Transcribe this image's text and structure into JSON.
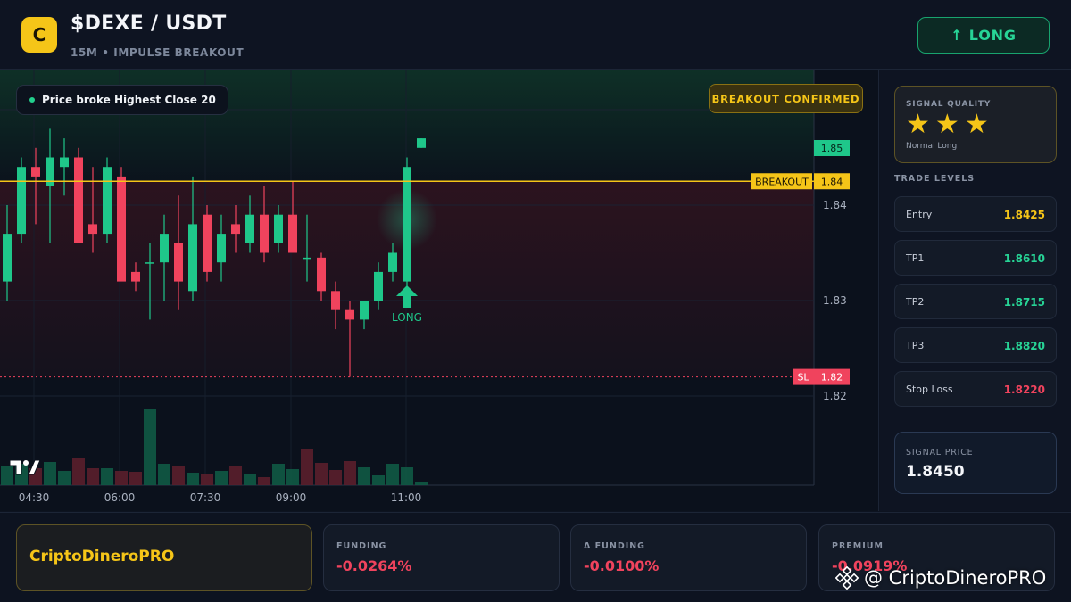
{
  "header": {
    "logo_letter": "C",
    "pair": "$DEXE / USDT",
    "subtitle": "15M • IMPULSE BREAKOUT",
    "signal_button": "↑ LONG"
  },
  "chart": {
    "annotation": "Price broke Highest Close 20",
    "status_badge": "BREAKOUT CONFIRMED",
    "signal_marker_label": "LONG",
    "breakout_label": "BREAKOUT",
    "sl_label": "SL"
  },
  "right_panel": {
    "quality_label": "SIGNAL QUALITY",
    "quality_stars": 3,
    "quality_desc": "Normal Long",
    "levels_title": "TRADE LEVELS",
    "levels": [
      {
        "label": "Entry",
        "value": "1.8425",
        "color": "#f5c518"
      },
      {
        "label": "TP1",
        "value": "1.8610",
        "color": "#27d496"
      },
      {
        "label": "TP2",
        "value": "1.8715",
        "color": "#27d496"
      },
      {
        "label": "TP3",
        "value": "1.8820",
        "color": "#27d496"
      },
      {
        "label": "Stop Loss",
        "value": "1.8220",
        "color": "#f0435d"
      }
    ],
    "signal_price_label": "SIGNAL PRICE",
    "signal_price": "1.8450"
  },
  "bottom": {
    "brand": "CriptoDineroPRO",
    "metrics": [
      {
        "label": "FUNDING",
        "value": "-0.0264%"
      },
      {
        "label": "Δ FUNDING",
        "value": "-0.0100%"
      },
      {
        "label": "PREMIUM",
        "value": "-0.0919%"
      }
    ],
    "watermark": "@ CriptoDineroPRO"
  },
  "colors": {
    "up": "#1fc78a",
    "down": "#f0435d",
    "accent": "#f5c518"
  },
  "chart_data": {
    "type": "candlestick",
    "x_ticks": [
      "04:30",
      "06:00",
      "07:30",
      "09:00",
      "11:00"
    ],
    "y_ticks": [
      "1.85",
      "1.84",
      "1.83",
      "1.82"
    ],
    "price_tags": {
      "last": "1.85",
      "breakout": "1.84",
      "stop_loss": "1.82"
    },
    "levels": {
      "breakout": 1.8425,
      "stop_loss": 1.822
    },
    "ylim": [
      1.8175,
      1.8575
    ],
    "candles": [
      {
        "o": 1.832,
        "h": 1.84,
        "l": 1.83,
        "c": 1.837
      },
      {
        "o": 1.837,
        "h": 1.845,
        "l": 1.836,
        "c": 1.844
      },
      {
        "o": 1.844,
        "h": 1.846,
        "l": 1.838,
        "c": 1.843
      },
      {
        "o": 1.842,
        "h": 1.848,
        "l": 1.836,
        "c": 1.845
      },
      {
        "o": 1.844,
        "h": 1.847,
        "l": 1.841,
        "c": 1.845
      },
      {
        "o": 1.845,
        "h": 1.846,
        "l": 1.838,
        "c": 1.836
      },
      {
        "o": 1.838,
        "h": 1.844,
        "l": 1.835,
        "c": 1.837
      },
      {
        "o": 1.837,
        "h": 1.845,
        "l": 1.836,
        "c": 1.844
      },
      {
        "o": 1.843,
        "h": 1.844,
        "l": 1.833,
        "c": 1.832
      },
      {
        "o": 1.833,
        "h": 1.834,
        "l": 1.831,
        "c": 1.832
      },
      {
        "o": 1.834,
        "h": 1.836,
        "l": 1.828,
        "c": 1.834
      },
      {
        "o": 1.834,
        "h": 1.839,
        "l": 1.83,
        "c": 1.837
      },
      {
        "o": 1.836,
        "h": 1.841,
        "l": 1.829,
        "c": 1.832
      },
      {
        "o": 1.831,
        "h": 1.843,
        "l": 1.83,
        "c": 1.838
      },
      {
        "o": 1.839,
        "h": 1.84,
        "l": 1.832,
        "c": 1.833
      },
      {
        "o": 1.834,
        "h": 1.839,
        "l": 1.832,
        "c": 1.837
      },
      {
        "o": 1.838,
        "h": 1.84,
        "l": 1.835,
        "c": 1.837
      },
      {
        "o": 1.836,
        "h": 1.841,
        "l": 1.835,
        "c": 1.839
      },
      {
        "o": 1.839,
        "h": 1.842,
        "l": 1.834,
        "c": 1.835
      },
      {
        "o": 1.836,
        "h": 1.84,
        "l": 1.835,
        "c": 1.839
      },
      {
        "o": 1.839,
        "h": 1.8425,
        "l": 1.836,
        "c": 1.835
      },
      {
        "o": 1.8345,
        "h": 1.839,
        "l": 1.832,
        "c": 1.8345
      },
      {
        "o": 1.8345,
        "h": 1.835,
        "l": 1.83,
        "c": 1.831
      },
      {
        "o": 1.831,
        "h": 1.832,
        "l": 1.827,
        "c": 1.829
      },
      {
        "o": 1.829,
        "h": 1.83,
        "l": 1.822,
        "c": 1.828
      },
      {
        "o": 1.828,
        "h": 1.83,
        "l": 1.827,
        "c": 1.83
      },
      {
        "o": 1.83,
        "h": 1.834,
        "l": 1.829,
        "c": 1.833
      },
      {
        "o": 1.833,
        "h": 1.836,
        "l": 1.832,
        "c": 1.835
      },
      {
        "o": 1.832,
        "h": 1.845,
        "l": 1.831,
        "c": 1.844
      },
      {
        "o": 1.846,
        "h": 1.847,
        "l": 1.846,
        "c": 1.847
      }
    ],
    "volumes": [
      {
        "v": 22,
        "up": true
      },
      {
        "v": 24,
        "up": true
      },
      {
        "v": 19,
        "up": false
      },
      {
        "v": 26,
        "up": true
      },
      {
        "v": 16,
        "up": true
      },
      {
        "v": 31,
        "up": false
      },
      {
        "v": 19,
        "up": false
      },
      {
        "v": 19,
        "up": true
      },
      {
        "v": 16,
        "up": false
      },
      {
        "v": 15,
        "up": false
      },
      {
        "v": 85,
        "up": true
      },
      {
        "v": 24,
        "up": true
      },
      {
        "v": 21,
        "up": false
      },
      {
        "v": 14,
        "up": true
      },
      {
        "v": 13,
        "up": false
      },
      {
        "v": 16,
        "up": true
      },
      {
        "v": 22,
        "up": false
      },
      {
        "v": 12,
        "up": true
      },
      {
        "v": 9,
        "up": false
      },
      {
        "v": 24,
        "up": true
      },
      {
        "v": 18,
        "up": true
      },
      {
        "v": 41,
        "up": false
      },
      {
        "v": 25,
        "up": false
      },
      {
        "v": 17,
        "up": false
      },
      {
        "v": 27,
        "up": false
      },
      {
        "v": 20,
        "up": true
      },
      {
        "v": 11,
        "up": true
      },
      {
        "v": 24,
        "up": true
      },
      {
        "v": 20,
        "up": true
      },
      {
        "v": 3,
        "up": true
      }
    ]
  }
}
